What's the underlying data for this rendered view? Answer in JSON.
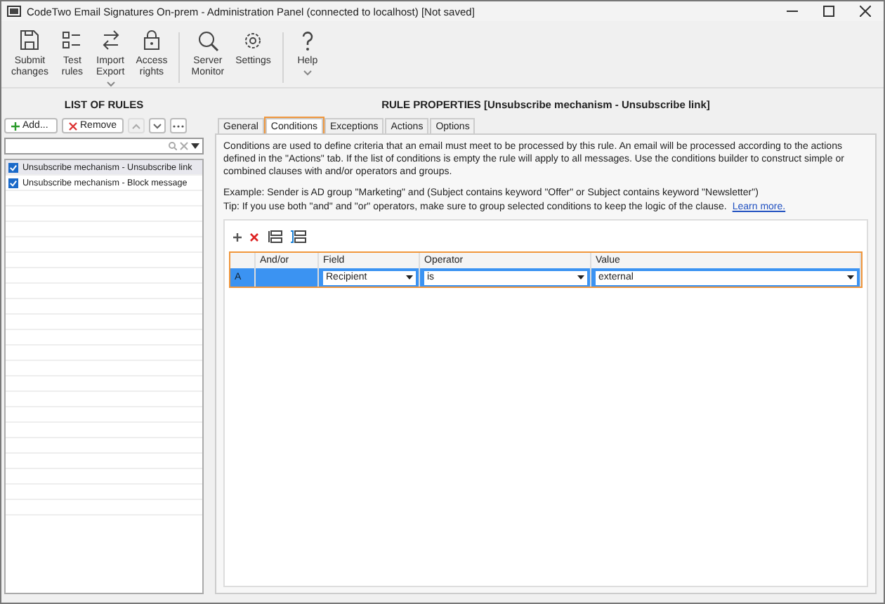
{
  "window": {
    "title": "CodeTwo Email Signatures On-prem - Administration Panel (connected to localhost) [Not saved]"
  },
  "toolbar": {
    "groups": [
      [
        {
          "kind": "save",
          "label": "Submit\nchanges",
          "dropdown": false
        },
        {
          "kind": "test",
          "label": "Test\nrules",
          "dropdown": false
        },
        {
          "kind": "import",
          "label": "Import\nExport",
          "dropdown": true
        },
        {
          "kind": "lock",
          "label": "Access\nrights",
          "dropdown": false
        }
      ],
      [
        {
          "kind": "monitor",
          "label": "Server\nMonitor",
          "dropdown": false
        },
        {
          "kind": "gear",
          "label": "Settings",
          "dropdown": false
        }
      ],
      [
        {
          "kind": "help",
          "label": "Help",
          "dropdown": true
        }
      ]
    ]
  },
  "rules_panel": {
    "title": "LIST OF RULES",
    "add_button": "Add...",
    "remove_button": "Remove",
    "rules": [
      {
        "name": "Unsubscribe mechanism - Unsubscribe link",
        "checked": true,
        "selected": true
      },
      {
        "name": "Unsubscribe mechanism - Block message",
        "checked": true,
        "selected": false
      }
    ]
  },
  "properties": {
    "title": "RULE PROPERTIES [Unsubscribe mechanism - Unsubscribe link]",
    "tabs": [
      {
        "label": "General",
        "selected": false
      },
      {
        "label": "Conditions",
        "selected": true
      },
      {
        "label": "Exceptions",
        "selected": false
      },
      {
        "label": "Actions",
        "selected": false
      },
      {
        "label": "Options",
        "selected": false
      }
    ],
    "description": "Conditions are used to define criteria that an email must meet to be processed by this rule. An email will be processed according to the actions defined in the \"Actions\" tab. If the list of conditions is empty the rule will apply to all messages. Use the conditions builder to construct simple or combined clauses with and/or operators and groups.",
    "example": "Example: Sender is AD group \"Marketing\" and (Subject contains keyword \"Offer\" or Subject contains keyword \"Newsletter\")",
    "tip": "Tip: If you use both \"and\" and \"or\" operators, make sure to group selected conditions to keep the logic of the clause.",
    "learn_more": "Learn more.",
    "columns": [
      "And/or",
      "Field",
      "Operator",
      "Value"
    ],
    "conditions": [
      {
        "label": "A",
        "field": "Recipient",
        "operator": "is",
        "value": "external",
        "selected": true
      }
    ]
  }
}
